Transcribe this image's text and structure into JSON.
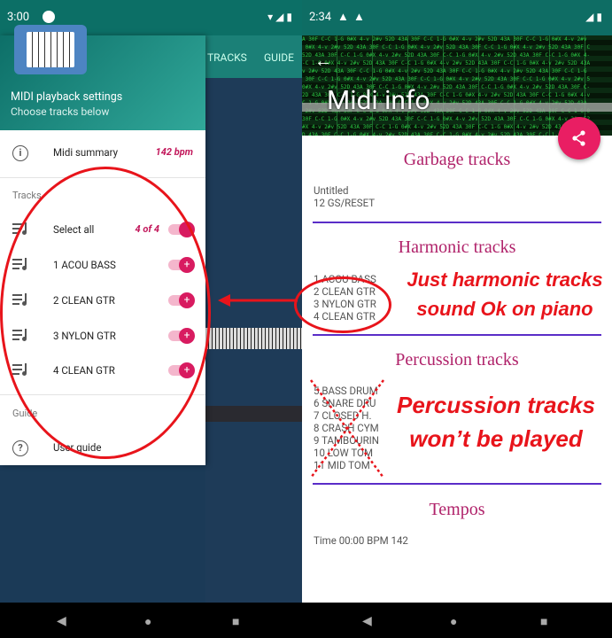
{
  "left_phone": {
    "status": {
      "time": "3:00"
    },
    "bg_tabs": [
      "TRACKS",
      "GUIDE"
    ],
    "drawer": {
      "title": "MIDI playback settings",
      "subtitle": "Choose tracks below",
      "summary": {
        "label": "Midi summary",
        "value": "142 bpm"
      },
      "tracks_section": "Tracks",
      "select_all": {
        "label": "Select all",
        "count": "4 of 4"
      },
      "tracks": [
        {
          "label": "1 ACOU BASS"
        },
        {
          "label": "2 CLEAN GTR"
        },
        {
          "label": "3 NYLON GTR"
        },
        {
          "label": "4 CLEAN GTR"
        }
      ],
      "guide_section": "Guide",
      "user_guide": "User guide"
    }
  },
  "right_phone": {
    "status": {
      "time": "2:34"
    },
    "title": "Midi info",
    "sections": {
      "garbage": {
        "heading": "Garbage tracks",
        "items": "Untitled\n12 GS/RESET"
      },
      "harmonic": {
        "heading": "Harmonic tracks",
        "items": "1 ACOU BASS\n2 CLEAN GTR\n3 NYLON GTR\n4 CLEAN GTR"
      },
      "percussion": {
        "heading": "Percussion tracks",
        "items": "5 BASS DRUM\n6 SNARE DRU\n7 CLOSED H.\n8 CRASH CYM\n9 TAMBOURIN\n10 LOW TOM\n11 MID TOM"
      },
      "tempos": {
        "heading": "Tempos",
        "items": "Time 00:00 BPM 142"
      }
    }
  },
  "annotations": {
    "harmonic_line1": "Just harmonic tracks",
    "harmonic_line2": "sound Ok on piano",
    "percussion_line1": "Percussion tracks",
    "percussion_line2": "won’t be played"
  },
  "colors": {
    "accent_pink": "#c2185b",
    "teal": "#0c6f66",
    "annotation_red": "#e8141b",
    "divider_purple": "#5a2dc8"
  }
}
